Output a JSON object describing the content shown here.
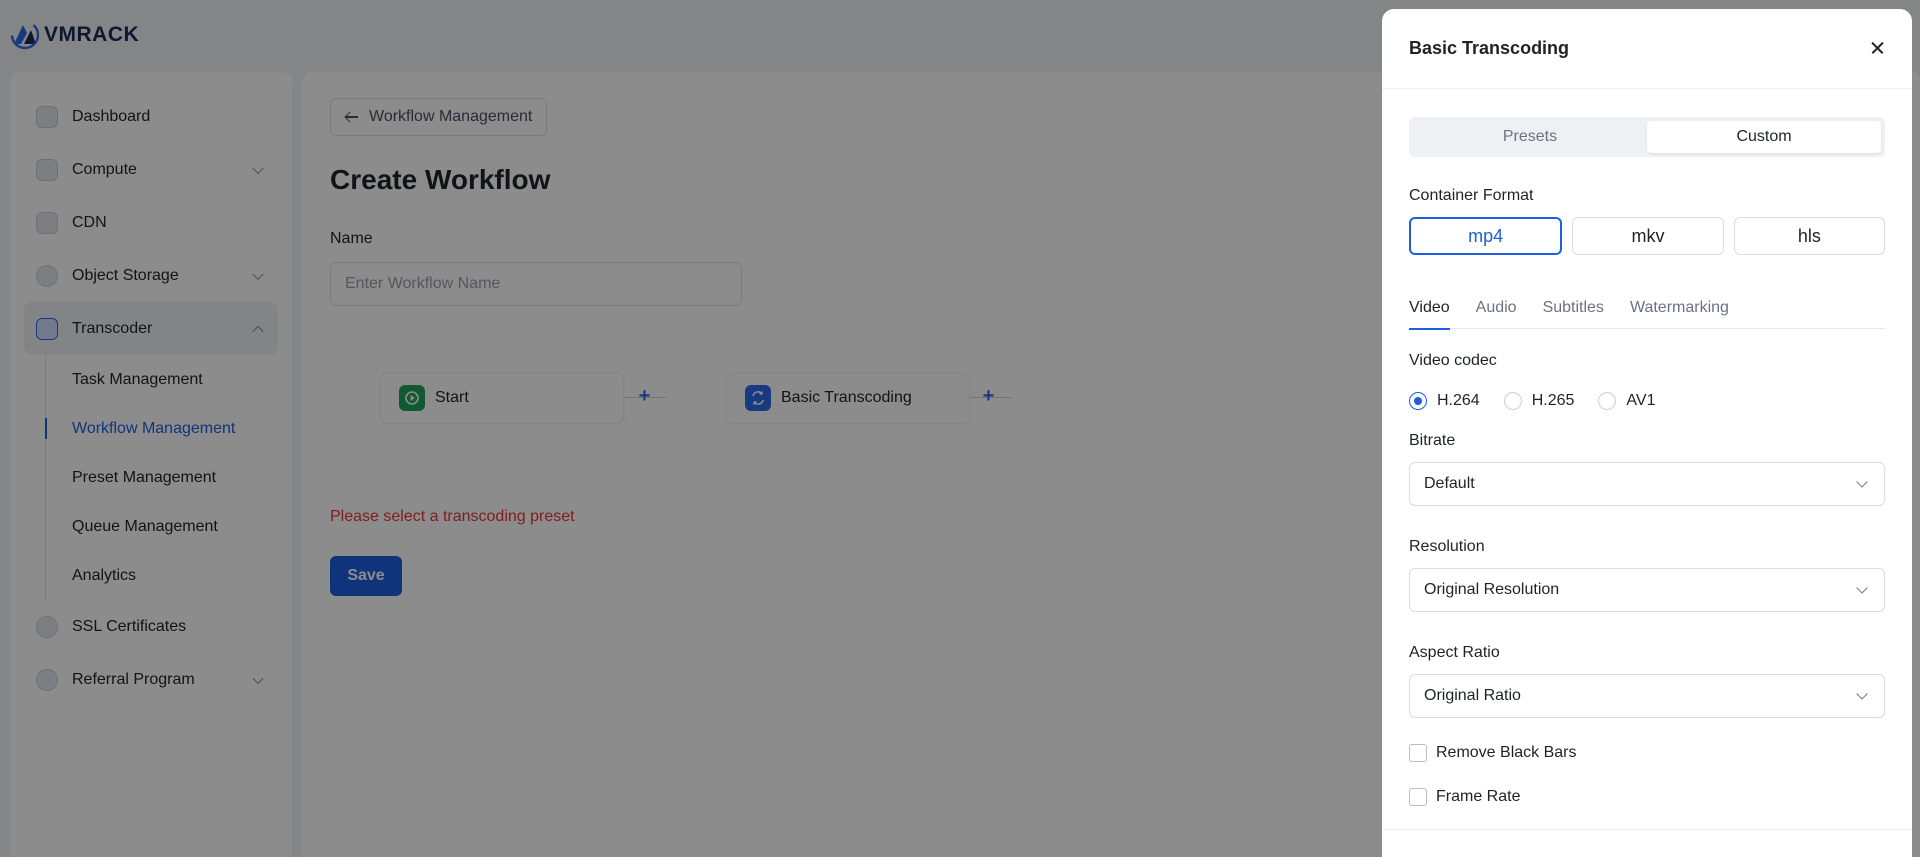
{
  "brand": {
    "name": "VMRACK"
  },
  "sidebar": {
    "items": [
      {
        "label": "Dashboard",
        "icon": "dashboard-icon",
        "has_chevron": false
      },
      {
        "label": "Compute",
        "icon": "compute-icon",
        "has_chevron": true
      },
      {
        "label": "CDN",
        "icon": "cdn-icon",
        "has_chevron": false
      },
      {
        "label": "Object Storage",
        "icon": "object-storage-icon",
        "has_chevron": true
      },
      {
        "label": "Transcoder",
        "icon": "transcoder-icon",
        "has_chevron": true,
        "expanded": true
      },
      {
        "label": "SSL Certificates",
        "icon": "ssl-certificate-icon",
        "has_chevron": false
      },
      {
        "label": "Referral Program",
        "icon": "referral-program-icon",
        "has_chevron": true
      }
    ],
    "transcoder_sub": [
      {
        "label": "Task Management",
        "active": false
      },
      {
        "label": "Workflow Management",
        "active": true
      },
      {
        "label": "Preset Management",
        "active": false
      },
      {
        "label": "Queue Management",
        "active": false
      },
      {
        "label": "Analytics",
        "active": false
      }
    ]
  },
  "main": {
    "back_label": "Workflow Management",
    "title": "Create Workflow",
    "name_label": "Name",
    "name_placeholder": "Enter Workflow Name",
    "flow": {
      "start_label": "Start",
      "transcode_label": "Basic Transcoding"
    },
    "error": "Please select a transcoding preset",
    "save_label": "Save"
  },
  "drawer": {
    "title": "Basic Transcoding",
    "mode_tabs": [
      {
        "label": "Presets",
        "active": false
      },
      {
        "label": "Custom",
        "active": true
      }
    ],
    "container_format": {
      "label": "Container Format",
      "options": [
        {
          "label": "mp4",
          "active": true
        },
        {
          "label": "mkv",
          "active": false
        },
        {
          "label": "hls",
          "active": false
        }
      ]
    },
    "tabs": [
      {
        "label": "Video",
        "active": true
      },
      {
        "label": "Audio",
        "active": false
      },
      {
        "label": "Subtitles",
        "active": false
      },
      {
        "label": "Watermarking",
        "active": false
      }
    ],
    "video_codec": {
      "label": "Video codec",
      "options": [
        {
          "label": "H.264",
          "checked": true
        },
        {
          "label": "H.265",
          "checked": false
        },
        {
          "label": "AV1",
          "checked": false
        }
      ]
    },
    "bitrate": {
      "label": "Bitrate",
      "value": "Default"
    },
    "resolution": {
      "label": "Resolution",
      "value": "Original Resolution"
    },
    "aspect_ratio": {
      "label": "Aspect Ratio",
      "value": "Original Ratio"
    },
    "checkboxes": [
      {
        "label": "Remove Black Bars",
        "checked": false
      },
      {
        "label": "Frame Rate",
        "checked": false
      }
    ]
  },
  "colors": {
    "accent": "#1d5fe0",
    "error": "#e53935",
    "overlay": "rgba(0,0,0,0.45)"
  }
}
